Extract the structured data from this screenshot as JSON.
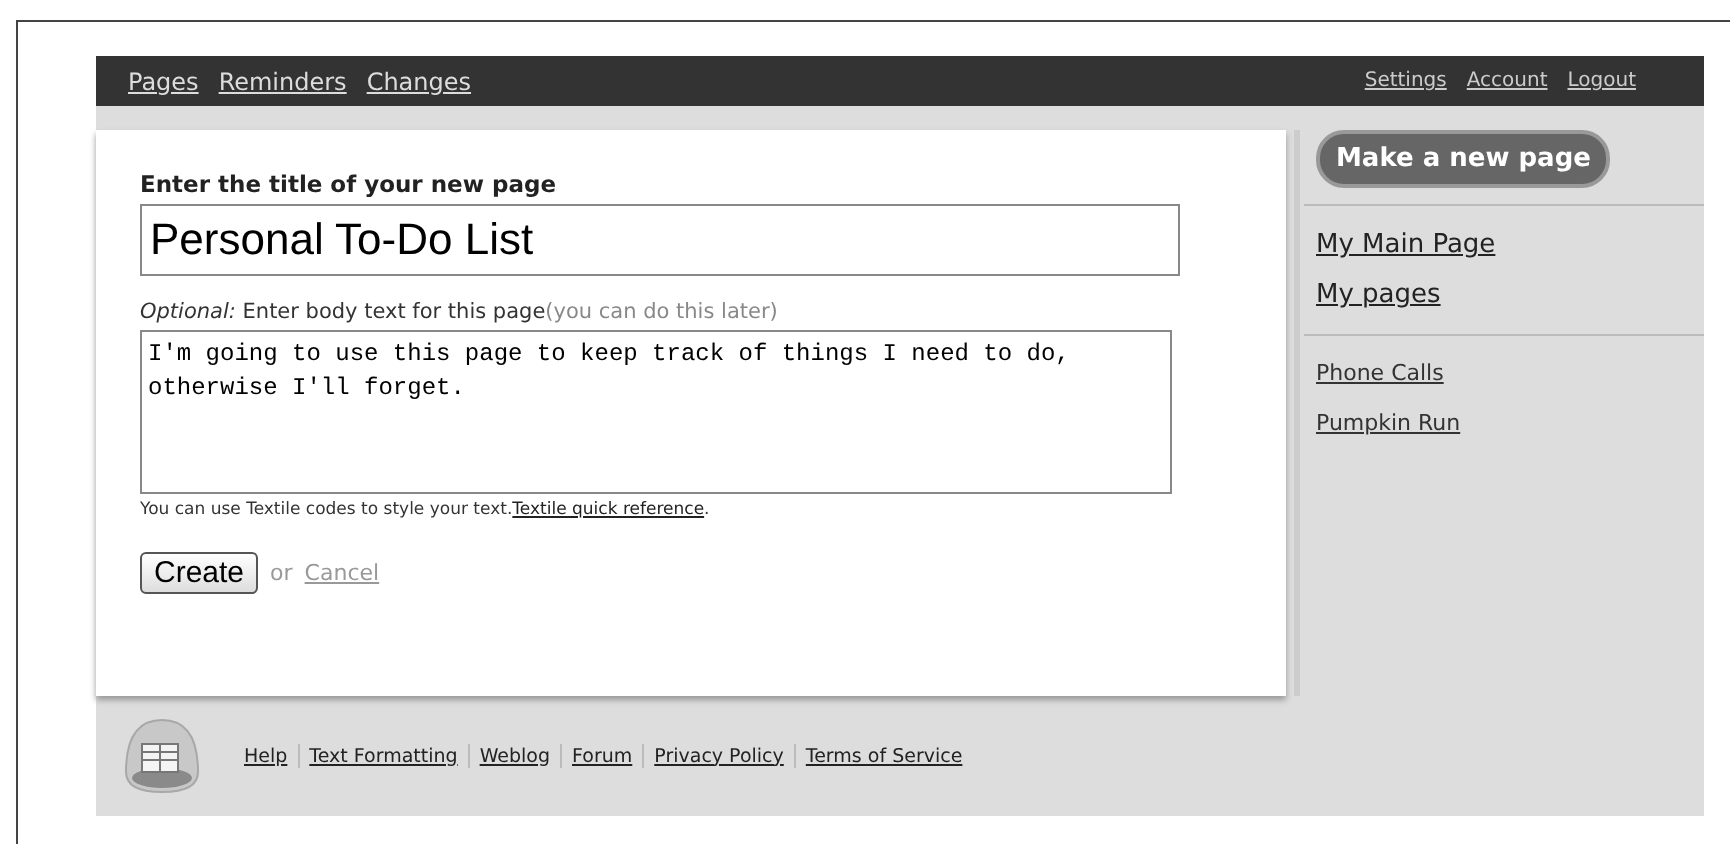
{
  "top_nav": {
    "left_links": [
      "Pages",
      "Reminders",
      "Changes"
    ],
    "right_links": [
      "Settings",
      "Account",
      "Logout"
    ]
  },
  "form": {
    "title_label": "Enter the title of your new page",
    "title_value": "Personal To-Do List",
    "body_label": "*Optional:* Enter body text for this page",
    "body_hint": "(you can do this later)",
    "body_value": "I'm going to use this page to keep track of things I need to do, otherwise I'll forget.",
    "textile_note": "You can use Textile codes to style your text.",
    "textile_link": "Textile quick reference",
    "textile_end": ".",
    "create_button": "Create",
    "or_text": "or",
    "cancel_link": "Cancel"
  },
  "sidebar": {
    "new_page_button": "Make a new page",
    "main_links": [
      "My Main Page",
      "My pages"
    ],
    "page_links": [
      "Phone Calls",
      "Pumpkin Run"
    ]
  },
  "footer": {
    "links": [
      "Help",
      "Text Formatting",
      "Weblog",
      "Forum",
      "Privacy Policy",
      "Terms of Service"
    ]
  }
}
